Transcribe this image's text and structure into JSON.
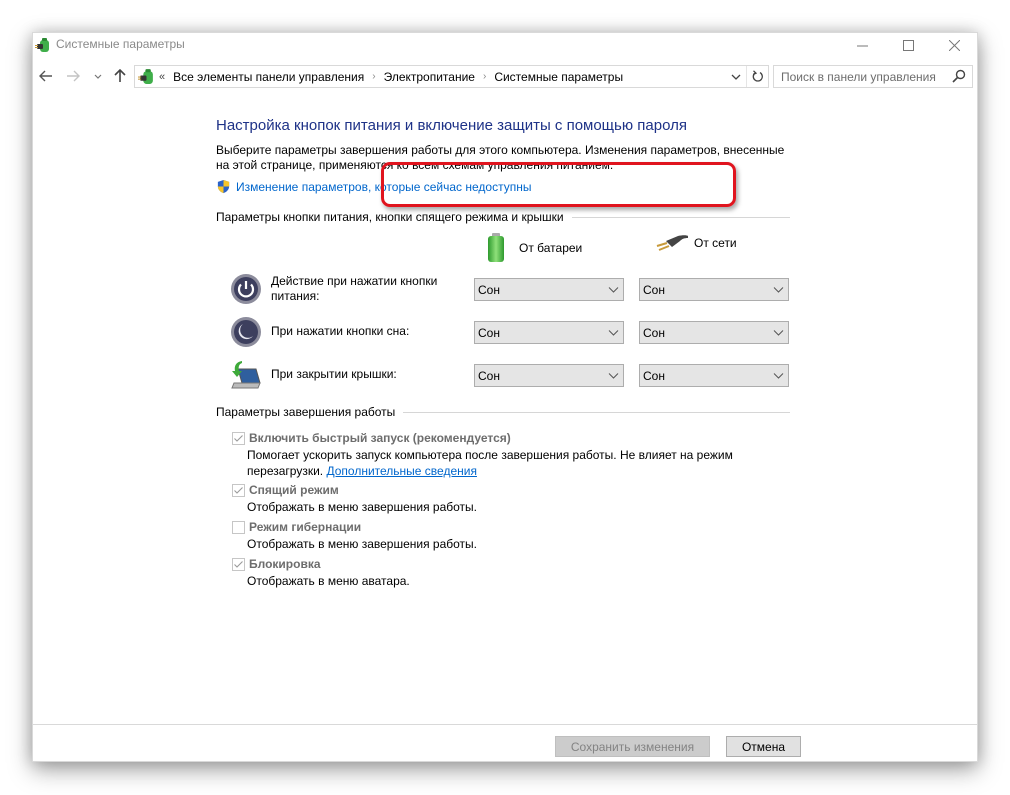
{
  "window": {
    "title": "Системные параметры",
    "controls": {
      "minimize": "minimize",
      "maximize": "maximize",
      "close": "close"
    }
  },
  "nav": {
    "back_icon": "arrow-left-icon",
    "forward_icon": "arrow-right-icon",
    "recent_icon": "chevron-down-icon",
    "up_icon": "arrow-up-icon",
    "address": {
      "overflow": "«",
      "breadcrumb": [
        "Все элементы панели управления",
        "Электропитание",
        "Системные параметры"
      ],
      "separator": "›"
    },
    "search": {
      "placeholder": "Поиск в панели управления"
    }
  },
  "main": {
    "title": "Настройка кнопок питания и включение защиты с помощью пароля",
    "description": "Выберите параметры завершения работы для этого компьютера. Изменения параметров, внесенные на этой странице, применяются ко всем схемам управления питанием.",
    "uac_link": "Изменение параметров, которые сейчас недоступны",
    "highlight_color": "#e0141e",
    "power_group": {
      "header": "Параметры кнопки питания, кнопки спящего режима и крышки",
      "columns": {
        "battery": "От батареи",
        "ac": "От сети"
      },
      "rows": [
        {
          "icon": "power-button-icon",
          "label_line1": "Действие при нажатии кнопки",
          "label_line2": "питания:",
          "battery": "Сон",
          "ac": "Сон"
        },
        {
          "icon": "sleep-button-icon",
          "label_line1": "При нажатии кнопки сна:",
          "label_line2": "",
          "battery": "Сон",
          "ac": "Сон"
        },
        {
          "icon": "laptop-lid-icon",
          "label_line1": "При закрытии крышки:",
          "label_line2": "",
          "battery": "Сон",
          "ac": "Сон"
        }
      ]
    },
    "shutdown_group": {
      "header": "Параметры завершения работы",
      "options": [
        {
          "label": "Включить быстрый запуск (рекомендуется)",
          "checked": true,
          "disabled": true,
          "desc_line1": "Помогает ускорить запуск компьютера после завершения работы. Не влияет на режим",
          "desc_line2": "перезагрузки. ",
          "link": "Дополнительные сведения"
        },
        {
          "label": "Спящий режим",
          "checked": true,
          "disabled": true,
          "desc_line1": "Отображать в меню завершения работы."
        },
        {
          "label": "Режим гибернации",
          "checked": false,
          "disabled": true,
          "desc_line1": "Отображать в меню завершения работы."
        },
        {
          "label": "Блокировка",
          "checked": true,
          "disabled": true,
          "desc_line1": "Отображать в меню аватара."
        }
      ]
    }
  },
  "footer": {
    "save": "Сохранить изменения",
    "cancel": "Отмена"
  }
}
